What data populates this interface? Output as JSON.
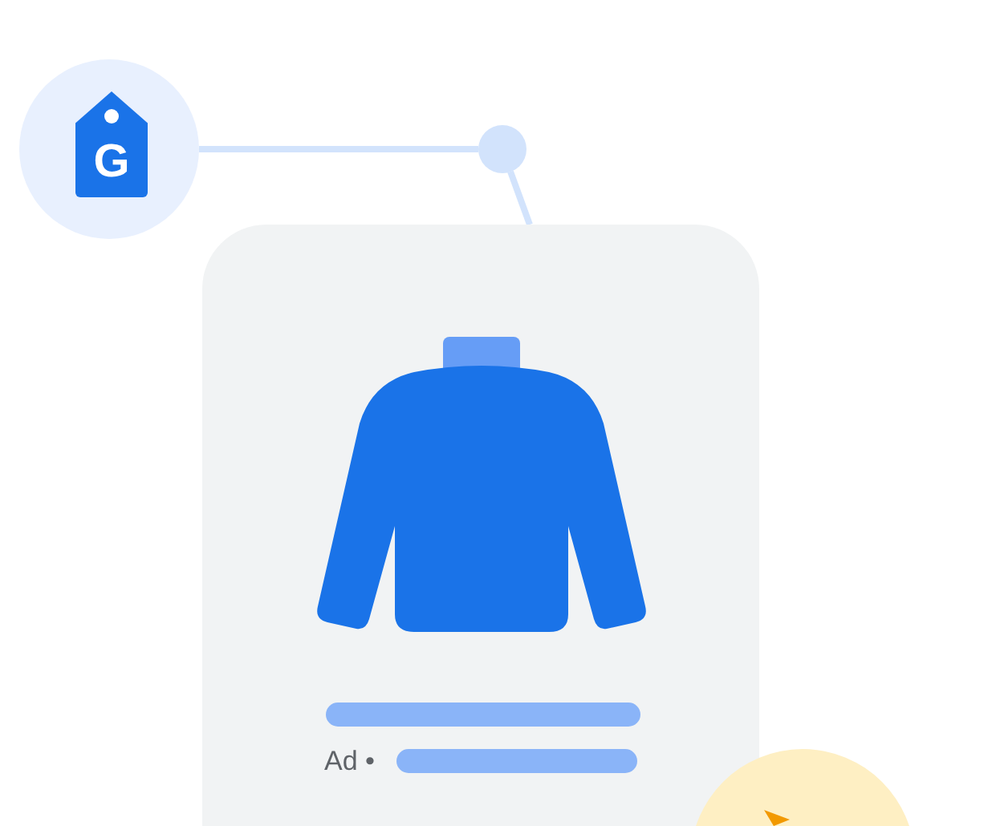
{
  "tag_badge": {
    "letter": "G"
  },
  "product_card": {
    "ad_label": "Ad •"
  }
}
